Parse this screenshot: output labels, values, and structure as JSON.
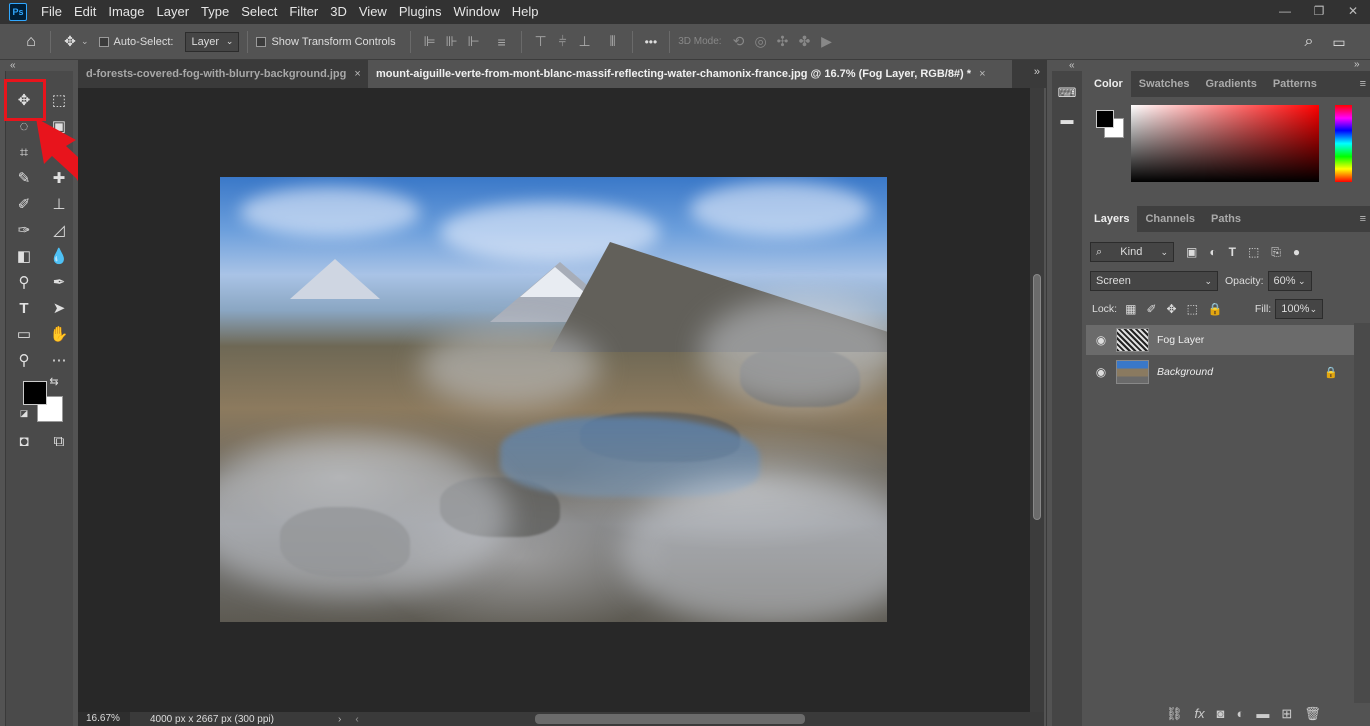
{
  "app": {
    "logo": "Ps",
    "menu": [
      "File",
      "Edit",
      "Image",
      "Layer",
      "Type",
      "Select",
      "Filter",
      "3D",
      "View",
      "Plugins",
      "Window",
      "Help"
    ],
    "window_controls": [
      "—",
      "❐",
      "✕"
    ]
  },
  "options_bar": {
    "auto_select_label": "Auto-Select:",
    "auto_select_value": "Layer",
    "show_transform_label": "Show Transform Controls",
    "three_d_mode_label": "3D Mode:",
    "more_label": "•••"
  },
  "tabs": [
    {
      "label": "d-forests-covered-fog-with-blurry-background.jpg",
      "close": "×",
      "active": false
    },
    {
      "label": "mount-aiguille-verte-from-mont-blanc-massif-reflecting-water-chamonix-france.jpg @ 16.7% (Fog Layer, RGB/8#) *",
      "close": "×",
      "active": true
    }
  ],
  "status": {
    "zoom": "16.67%",
    "doc_info": "4000 px x 2667 px (300 ppi)"
  },
  "color_panel": {
    "tabs": [
      "Color",
      "Swatches",
      "Gradients",
      "Patterns"
    ],
    "active_tab": "Color",
    "foreground": "#000000",
    "background": "#ffffff"
  },
  "layers_panel": {
    "tabs": [
      "Layers",
      "Channels",
      "Paths"
    ],
    "active_tab": "Layers",
    "filter_label": "Kind",
    "blend_mode": "Screen",
    "opacity_label": "Opacity:",
    "opacity_value": "60%",
    "lock_label": "Lock:",
    "fill_label": "Fill:",
    "fill_value": "100%",
    "layers": [
      {
        "name": "Fog Layer",
        "selected": true,
        "locked": false
      },
      {
        "name": "Background",
        "selected": false,
        "locked": true
      }
    ]
  },
  "annotations": {
    "highlight_color": "#e8141c"
  }
}
